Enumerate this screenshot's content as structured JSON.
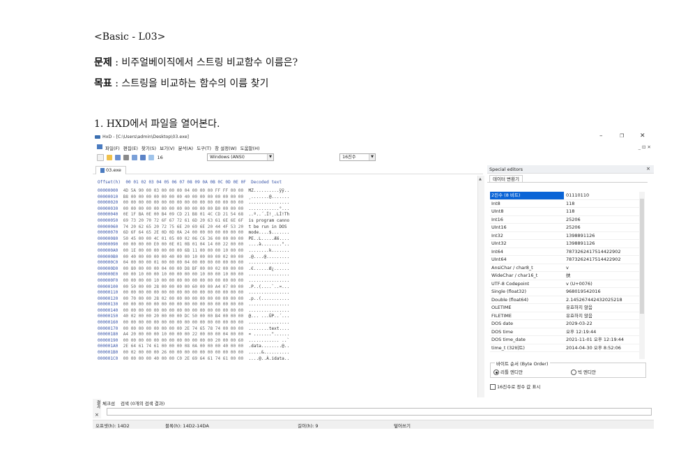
{
  "document": {
    "heading": "<Basic - L03>",
    "question_label": "문제",
    "question_text": " : 비주얼베이직에서 스트링 비교함수 이름은?",
    "goal_label": "목표",
    "goal_text": " : 스트링을 비교하는 함수의 이름 찾기",
    "step1": "1. HXD에서 파일을 열어본다."
  },
  "window": {
    "title": "HxD - [C:\\Users\\admin\\Desktop\\03.exe]",
    "min": "–",
    "max": "❐",
    "close": "✕",
    "inner_controls": "_ ⊡ ✕"
  },
  "menu": [
    "파일(F)",
    "편집(E)",
    "찾기(S)",
    "보기(V)",
    "분석(A)",
    "도구(T)",
    "창 설정(W)",
    "도움말(H)"
  ],
  "toolbar": {
    "bytes_per_row": "16",
    "charset": "Windows (ANSI)",
    "offset_base": "16진수"
  },
  "file_tab": "03.exe",
  "hex": {
    "header": "Offset(h)  00 01 02 03 04 05 06 07 08 09 0A 0B 0C 0D 0E 0F  Decoded text",
    "rows": [
      [
        "00000000",
        "4D 5A 90 00 03 00 00 00 04 00 00 00 FF FF 00 00",
        "MZ..........ÿÿ.."
      ],
      [
        "00000010",
        "B8 00 00 00 00 00 00 00 40 00 00 00 00 00 00 00",
        "¸.......@......."
      ],
      [
        "00000020",
        "00 00 00 00 00 00 00 00 00 00 00 00 00 00 00 00",
        "................"
      ],
      [
        "00000030",
        "00 00 00 00 00 00 00 00 00 00 00 00 B0 00 00 00",
        "............°..."
      ],
      [
        "00000040",
        "0E 1F BA 0E 00 B4 09 CD 21 B8 01 4C CD 21 54 68",
        "..º..´.Í!¸.LÍ!Th"
      ],
      [
        "00000050",
        "69 73 20 70 72 6F 67 72 61 6D 20 63 61 6E 6E 6F",
        "is program canno"
      ],
      [
        "00000060",
        "74 20 62 65 20 72 75 6E 20 69 6E 20 44 4F 53 20",
        "t be run in DOS "
      ],
      [
        "00000070",
        "6D 6F 64 65 2E 0D 0D 0A 24 00 00 00 00 00 00 00",
        "mode....$......."
      ],
      [
        "00000080",
        "50 45 00 00 4C 01 05 00 02 06 C6 36 00 00 00 00",
        "PE..L.....Æ6...."
      ],
      [
        "00000090",
        "00 00 00 00 E0 00 0E 01 0B 01 04 14 00 22 00 00",
        "....à........\".."
      ],
      [
        "000000A0",
        "00 1E 00 00 00 00 00 00 6B 11 00 00 00 10 00 00",
        "........k......."
      ],
      [
        "000000B0",
        "00 40 00 00 00 00 40 00 00 10 00 00 00 02 00 00",
        ".@....@........."
      ],
      [
        "000000C0",
        "04 00 00 00 01 00 00 00 04 00 00 00 00 00 00 00",
        "................"
      ],
      [
        "000000D0",
        "00 80 00 00 00 04 00 00 D8 BF 00 00 02 00 00 00",
        ".€......Ø¿......"
      ],
      [
        "000000E0",
        "00 00 10 00 00 10 00 00 00 00 10 00 00 10 00 00",
        "................"
      ],
      [
        "000000F0",
        "00 00 00 00 10 00 00 00 00 00 00 00 00 00 00 00",
        "................"
      ],
      [
        "00000100",
        "00 50 00 00 28 00 00 00 00 60 00 00 A4 07 00 00",
        ".P..(....`..¤..."
      ],
      [
        "00000110",
        "00 00 00 00 00 00 00 00 00 00 00 00 00 00 00 00",
        "................"
      ],
      [
        "00000120",
        "00 70 00 00 28 02 00 00 00 00 00 00 00 00 00 00",
        ".p..(..........."
      ],
      [
        "00000130",
        "00 00 00 00 00 00 00 00 00 00 00 00 00 00 00 00",
        "................"
      ],
      [
        "00000140",
        "00 00 00 00 00 00 00 00 00 00 00 00 00 00 00 00",
        "................"
      ],
      [
        "00000150",
        "40 02 00 00 20 00 00 00 DC 50 00 00 B4 00 00 00",
        "@... ...ÜP..´..."
      ],
      [
        "00000160",
        "00 00 00 00 00 00 00 00 00 00 00 00 00 00 00 00",
        "................"
      ],
      [
        "00000170",
        "00 00 00 00 00 00 00 00 2E 74 65 78 74 00 00 00",
        "........text...."
      ],
      [
        "00000180",
        "A4 20 00 00 00 10 00 00 00 22 00 00 00 04 00 00",
        "¤ .......\"......"
      ],
      [
        "00000190",
        "00 00 00 00 00 00 00 00 00 00 00 00 20 00 00 60",
        "............ ..`"
      ],
      [
        "000001A0",
        "2E 64 61 74 61 00 00 00 08 0A 00 00 00 40 00 00",
        ".data........@.."
      ],
      [
        "000001B0",
        "00 02 00 00 00 26 00 00 00 00 00 00 00 00 00 00",
        ".....&.........."
      ],
      [
        "000001C0",
        "00 00 00 00 40 00 00 C0 2E 69 64 61 74 61 00 00",
        "....@..À.idata.."
      ]
    ]
  },
  "special_editors": {
    "title": "Special editors",
    "close": "×",
    "tab": "데이터 변환기",
    "rows": [
      [
        "2진수 (8 비트)",
        "01110110"
      ],
      [
        "Int8",
        "118"
      ],
      [
        "UInt8",
        "118"
      ],
      [
        "Int16",
        "25206"
      ],
      [
        "UInt16",
        "25206"
      ],
      [
        "Int32",
        "1398891126"
      ],
      [
        "UInt32",
        "1398891126"
      ],
      [
        "Int64",
        "7873262417514422902"
      ],
      [
        "UInt64",
        "7873262417514422902"
      ],
      [
        "AnsiChar / char8_t",
        "v"
      ],
      [
        "WideChar / char16_t",
        "扶"
      ],
      [
        "UTF-8 Codepoint",
        "v (U+0076)"
      ],
      [
        "Single (float32)",
        "968019542016"
      ],
      [
        "Double (float64)",
        "2.14526744243202521​8"
      ],
      [
        "OLETIME",
        "유효하지 않음"
      ],
      [
        "FILETIME",
        "유효하지 않음"
      ],
      [
        "DOS date",
        "2029-03-22"
      ],
      [
        "DOS time",
        "오후 12:19:44"
      ],
      [
        "DOS time_date",
        "2021-11-01 오후 12:19:44"
      ],
      [
        "time_t (32비트)",
        "2014-04-30 오후 8:52:06"
      ]
    ],
    "byte_order_label": "바이트 순서 (Byte Order)",
    "little_endian": "리틀 엔디안",
    "big_endian": "빅 엔디안",
    "hex_int_check": "16진수로 정수 값 표시"
  },
  "results": {
    "side_label": "결과",
    "tab_check": "체크섬",
    "tab_search": "검색 (0개의 검색 결과)",
    "close": "×"
  },
  "status": {
    "offset": "오프셋(h): 14D2",
    "block": "블록(h): 14D2-14DA",
    "length": "길이(h): 9",
    "mode": "덮어쓰기"
  }
}
